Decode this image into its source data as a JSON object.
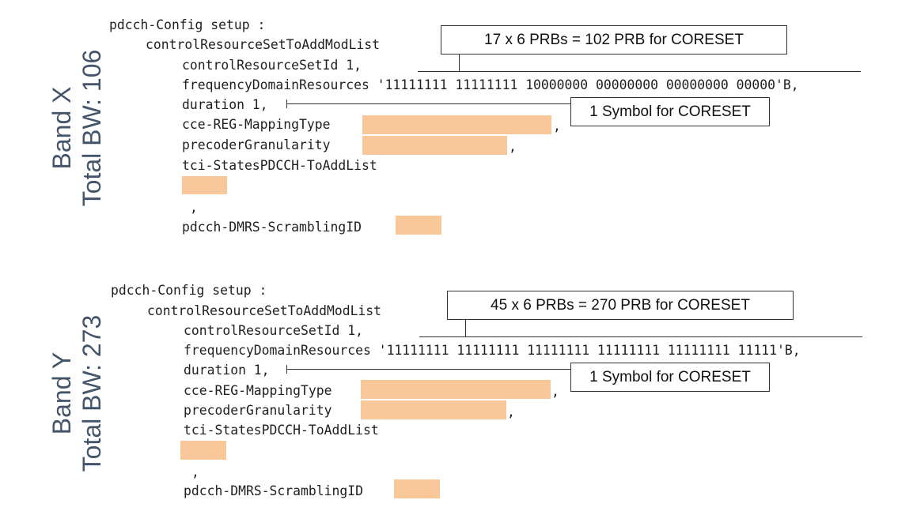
{
  "sections": [
    {
      "side_label_line1": "Band X",
      "side_label_line2": "Total BW: 106",
      "code": {
        "line1": "pdcch-Config setup :",
        "line2": "controlResourceSetToAddModList",
        "line3": "controlResourceSetId 1,",
        "line4": "frequencyDomainResources '11111111 11111111 10000000 00000000 00000000 00000'B,",
        "line5": "duration 1,",
        "line6": "cce-REG-MappingType",
        "line7": "precoderGranularity",
        "line8": "tci-StatesPDCCH-ToAddList",
        "line9": ",",
        "line10": "pdcch-DMRS-ScramblingID",
        "comma": ","
      },
      "callout_prb": "17 x 6 PRBs = 102 PRB for CORESET",
      "callout_symbol": "1 Symbol for CORESET"
    },
    {
      "side_label_line1": "Band Y",
      "side_label_line2": "Total BW: 273",
      "code": {
        "line1": "pdcch-Config setup :",
        "line2": "controlResourceSetToAddModList",
        "line3": "controlResourceSetId 1,",
        "line4": "frequencyDomainResources '11111111 11111111 11111111 11111111 11111111 11111'B,",
        "line5": "duration 1,",
        "line6": "cce-REG-MappingType",
        "line7": "precoderGranularity",
        "line8": "tci-StatesPDCCH-ToAddList",
        "line9": ",",
        "line10": "pdcch-DMRS-ScramblingID",
        "comma": ","
      },
      "callout_prb": "45 x 6 PRBs = 270 PRB for CORESET",
      "callout_symbol": "1 Symbol for CORESET"
    }
  ],
  "colors": {
    "side_label": "#44546a",
    "redaction": "#f9c89a",
    "code_text": "#1f1f1f"
  }
}
